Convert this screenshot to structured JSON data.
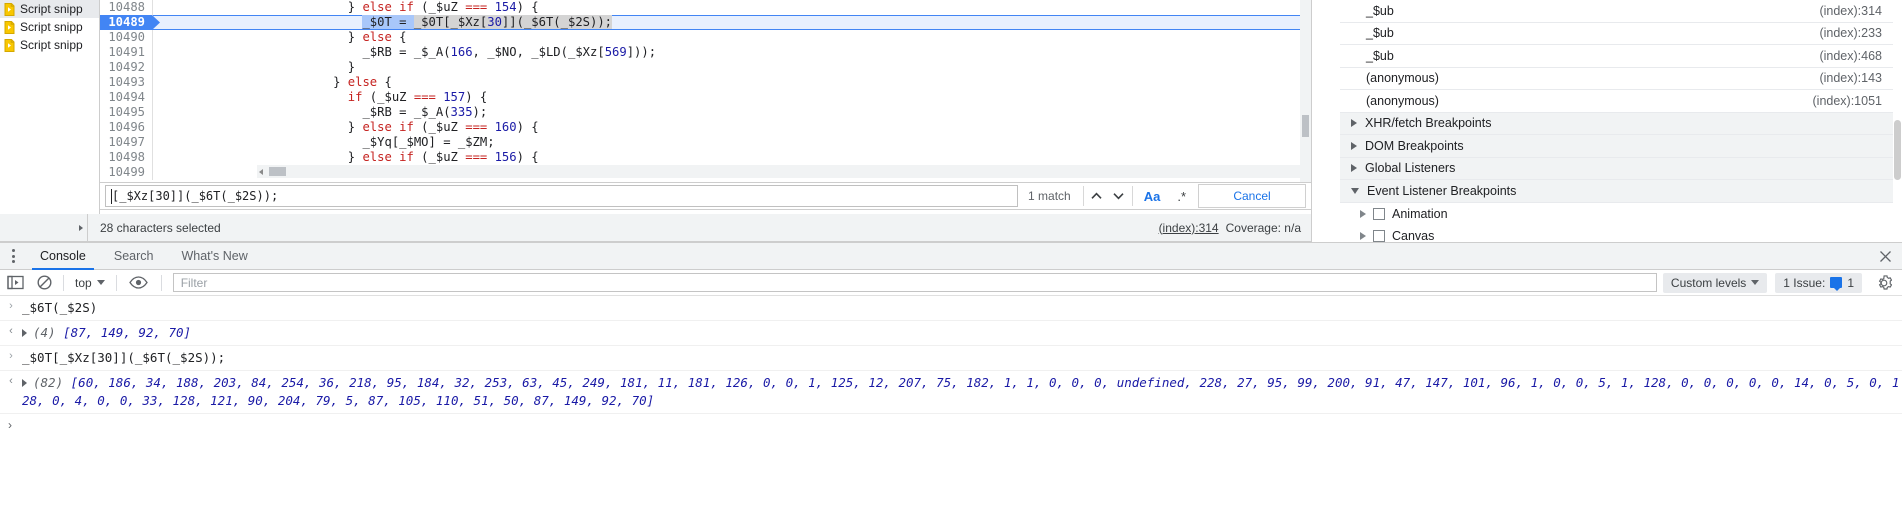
{
  "navigator": {
    "items": [
      {
        "label": "Script snipp",
        "icon": "snippet-icon",
        "selected": true
      },
      {
        "label": "Script snipp",
        "icon": "snippet-icon",
        "selected": false
      },
      {
        "label": "Script snipp",
        "icon": "snippet-icon",
        "selected": false
      }
    ]
  },
  "editor": {
    "current_line": "10489",
    "lines": [
      {
        "num": "10488",
        "indent": 26,
        "tokens": [
          {
            "t": "} ",
            "c": "plain"
          },
          {
            "t": "else if",
            "c": "kw"
          },
          {
            "t": " (",
            "c": "plain"
          },
          {
            "t": "_$uZ",
            "c": "var"
          },
          {
            "t": " ",
            "c": "plain"
          },
          {
            "t": "===",
            "c": "kw"
          },
          {
            "t": " ",
            "c": "plain"
          },
          {
            "t": "154",
            "c": "num"
          },
          {
            "t": ") {",
            "c": "plain"
          }
        ]
      },
      {
        "num": "10489",
        "indent": 28,
        "current": true,
        "tokens": [
          {
            "t": "_$0T",
            "c": "var"
          },
          {
            "t": " = ",
            "c": "plain"
          },
          {
            "t": "_$0T",
            "c": "var"
          },
          {
            "t": "[",
            "c": "plain"
          },
          {
            "t": "_$Xz",
            "c": "var"
          },
          {
            "t": "[",
            "c": "plain"
          },
          {
            "t": "30",
            "c": "num"
          },
          {
            "t": "]](",
            "c": "plain"
          },
          {
            "t": "_$6T",
            "c": "var"
          },
          {
            "t": "(",
            "c": "plain"
          },
          {
            "t": "_$2S",
            "c": "var"
          },
          {
            "t": "));",
            "c": "plain"
          }
        ]
      },
      {
        "num": "10490",
        "indent": 26,
        "tokens": [
          {
            "t": "} ",
            "c": "plain"
          },
          {
            "t": "else",
            "c": "kw"
          },
          {
            "t": " {",
            "c": "plain"
          }
        ]
      },
      {
        "num": "10491",
        "indent": 28,
        "tokens": [
          {
            "t": "_$RB",
            "c": "var"
          },
          {
            "t": " = ",
            "c": "plain"
          },
          {
            "t": "_$_A",
            "c": "var"
          },
          {
            "t": "(",
            "c": "plain"
          },
          {
            "t": "166",
            "c": "num"
          },
          {
            "t": ", ",
            "c": "plain"
          },
          {
            "t": "_$NO",
            "c": "var"
          },
          {
            "t": ", ",
            "c": "plain"
          },
          {
            "t": "_$LD",
            "c": "var"
          },
          {
            "t": "(",
            "c": "plain"
          },
          {
            "t": "_$Xz",
            "c": "var"
          },
          {
            "t": "[",
            "c": "plain"
          },
          {
            "t": "569",
            "c": "num"
          },
          {
            "t": "]));",
            "c": "plain"
          }
        ]
      },
      {
        "num": "10492",
        "indent": 26,
        "tokens": [
          {
            "t": "}",
            "c": "plain"
          }
        ]
      },
      {
        "num": "10493",
        "indent": 24,
        "tokens": [
          {
            "t": "} ",
            "c": "plain"
          },
          {
            "t": "else",
            "c": "kw"
          },
          {
            "t": " {",
            "c": "plain"
          }
        ]
      },
      {
        "num": "10494",
        "indent": 26,
        "tokens": [
          {
            "t": "if",
            "c": "kw"
          },
          {
            "t": " (",
            "c": "plain"
          },
          {
            "t": "_$uZ",
            "c": "var"
          },
          {
            "t": " ",
            "c": "plain"
          },
          {
            "t": "===",
            "c": "kw"
          },
          {
            "t": " ",
            "c": "plain"
          },
          {
            "t": "157",
            "c": "num"
          },
          {
            "t": ") {",
            "c": "plain"
          }
        ]
      },
      {
        "num": "10495",
        "indent": 28,
        "tokens": [
          {
            "t": "_$RB",
            "c": "var"
          },
          {
            "t": " = ",
            "c": "plain"
          },
          {
            "t": "_$_A",
            "c": "var"
          },
          {
            "t": "(",
            "c": "plain"
          },
          {
            "t": "335",
            "c": "num"
          },
          {
            "t": ");",
            "c": "plain"
          }
        ]
      },
      {
        "num": "10496",
        "indent": 26,
        "tokens": [
          {
            "t": "} ",
            "c": "plain"
          },
          {
            "t": "else if",
            "c": "kw"
          },
          {
            "t": " (",
            "c": "plain"
          },
          {
            "t": "_$uZ",
            "c": "var"
          },
          {
            "t": " ",
            "c": "plain"
          },
          {
            "t": "===",
            "c": "kw"
          },
          {
            "t": " ",
            "c": "plain"
          },
          {
            "t": "160",
            "c": "num"
          },
          {
            "t": ") {",
            "c": "plain"
          }
        ]
      },
      {
        "num": "10497",
        "indent": 28,
        "tokens": [
          {
            "t": "_$Yq",
            "c": "var"
          },
          {
            "t": "[",
            "c": "plain"
          },
          {
            "t": "_$MO",
            "c": "var"
          },
          {
            "t": "] = ",
            "c": "plain"
          },
          {
            "t": "_$ZM",
            "c": "var"
          },
          {
            "t": ";",
            "c": "plain"
          }
        ]
      },
      {
        "num": "10498",
        "indent": 26,
        "tokens": [
          {
            "t": "} ",
            "c": "plain"
          },
          {
            "t": "else if",
            "c": "kw"
          },
          {
            "t": " (",
            "c": "plain"
          },
          {
            "t": "_$uZ",
            "c": "var"
          },
          {
            "t": " ",
            "c": "plain"
          },
          {
            "t": "===",
            "c": "kw"
          },
          {
            "t": " ",
            "c": "plain"
          },
          {
            "t": "156",
            "c": "num"
          },
          {
            "t": ") {",
            "c": "plain"
          }
        ]
      },
      {
        "num": "10499",
        "indent": 0,
        "tokens": []
      }
    ]
  },
  "findbar": {
    "query": "[_$Xz[30]](_$6T(_$2S));",
    "matches": "1 match",
    "prev_label": "∧",
    "next_label": "∨",
    "match_case_label": "Aa",
    "regex_label": ".*",
    "cancel_label": "Cancel"
  },
  "status": {
    "selection": "28 characters selected",
    "index_link": "(index):314",
    "coverage": "Coverage: n/a"
  },
  "debugger": {
    "callstack": [
      {
        "fn": "_$ub",
        "loc": "(index):314"
      },
      {
        "fn": "_$ub",
        "loc": "(index):233"
      },
      {
        "fn": "_$ub",
        "loc": "(index):468"
      },
      {
        "fn": "(anonymous)",
        "loc": "(index):143"
      },
      {
        "fn": "(anonymous)",
        "loc": "(index):1051"
      }
    ],
    "sections": [
      {
        "label": "XHR/fetch Breakpoints",
        "expanded": false
      },
      {
        "label": "DOM Breakpoints",
        "expanded": false
      },
      {
        "label": "Global Listeners",
        "expanded": false
      },
      {
        "label": "Event Listener Breakpoints",
        "expanded": true
      }
    ],
    "event_listener_items": [
      {
        "label": "Animation",
        "checked": false
      },
      {
        "label": "Canvas",
        "checked": false
      }
    ]
  },
  "drawer": {
    "tabs": [
      {
        "label": "Console",
        "active": true
      },
      {
        "label": "Search",
        "active": false
      },
      {
        "label": "What's New",
        "active": false
      }
    ],
    "toolbar": {
      "context": "top",
      "filter_placeholder": "Filter",
      "levels_label": "Custom levels",
      "issues_label": "1 Issue:",
      "issues_count": "1"
    },
    "messages": [
      {
        "kind": "input",
        "gutter": "›",
        "text": "_$6T(_$2S)"
      },
      {
        "kind": "output",
        "gutter": "‹",
        "expandable": true,
        "length": "(4)",
        "value": "[87, 149, 92, 70]"
      },
      {
        "kind": "input",
        "gutter": "›",
        "text": "_$0T[_$Xz[30]](_$6T(_$2S));"
      },
      {
        "kind": "output",
        "gutter": "‹",
        "expandable": true,
        "length": "(82)",
        "value": "[60, 186, 34, 188, 203, 84, 254, 36, 218, 95, 184, 32, 253, 63, 45, 249, 181, 11, 181, 126, 0, 0, 1, 125, 12, 207, 75, 182, 1, 1, 0, 0, 0, undefined, 228, 27, 95, 99, 200, 91, 47, 147, 101, 96, 1, 0, 0, 5, 1, 128, 0, 0, 0, 0, 0, 14, 0, 5, 0, 128, 0, 4, 0, 0, 33, 128, 121, 90, 204, 79, 5, 87, 105, 110, 51, 50, 87, 149, 92, 70]"
      }
    ],
    "prompt": "›"
  },
  "colors": {
    "accent": "#1a73e8",
    "exec_line": "#4285f4",
    "exec_line_bg": "#e8f0fe",
    "keyword": "#c5221f",
    "number": "#1a1aa6",
    "toolbar_bg": "#f1f3f4"
  }
}
